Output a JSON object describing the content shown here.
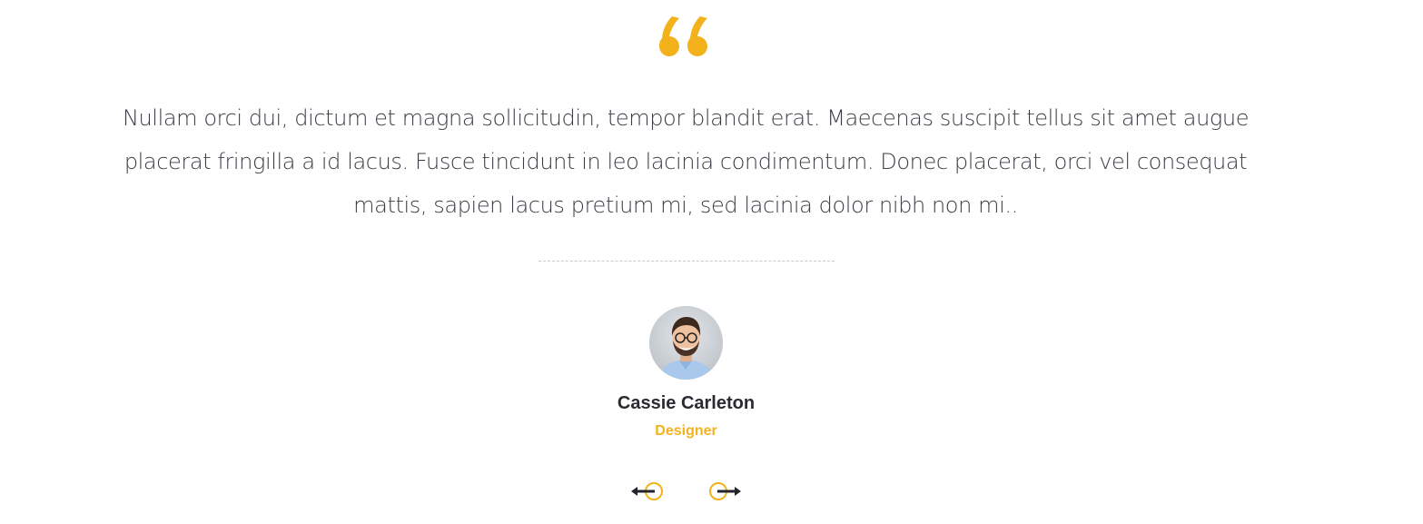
{
  "testimonial": {
    "quote_icon": "quote-open-icon",
    "text": "Nullam orci dui, dictum et magna sollicitudin, tempor blandit erat. Maecenas suscipit tellus sit amet augue placerat fringilla a id lacus. Fusce tincidunt in leo lacinia condimentum. Donec placerat, orci vel consequat mattis, sapien lacus pretium mi, sed lacinia dolor nibh non mi..",
    "author": {
      "name": "Cassie Carleton",
      "role": "Designer",
      "avatar_icon": "avatar-photo"
    }
  },
  "navigation": {
    "prev_icon": "arrow-left-icon",
    "next_icon": "arrow-right-icon"
  },
  "colors": {
    "accent": "#f3b21c",
    "text": "#3b3b45",
    "heading": "#2a2a33",
    "divider": "#c9c9cf"
  }
}
